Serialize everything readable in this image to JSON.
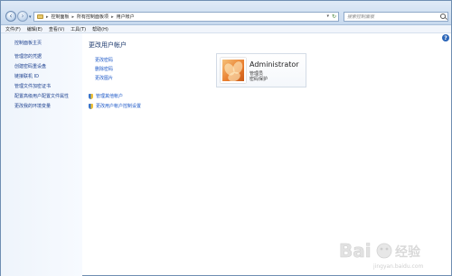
{
  "address_bar": {
    "crumbs": [
      "控制面板",
      "所有控制面板项",
      "用户帐户"
    ],
    "search_placeholder": "搜索控制面板"
  },
  "menu": {
    "items": [
      "文件(F)",
      "编辑(E)",
      "查看(V)",
      "工具(T)",
      "帮助(H)"
    ]
  },
  "left_pane": {
    "home": "控制面板主页",
    "links": [
      "管理您的凭据",
      "创建密码重设盘",
      "链接联机 ID",
      "管理文件加密证书",
      "配置高级用户配置文件属性",
      "更改我的环境变量"
    ]
  },
  "main": {
    "title": "更改用户帐户",
    "links": [
      "更改密码",
      "删除密码",
      "更改图片"
    ],
    "shield_links": [
      "管理其他帐户",
      "更改用户帐户控制设置"
    ]
  },
  "user": {
    "name": "Administrator",
    "role": "管理员",
    "password_status": "密码保护"
  },
  "watermark": {
    "text": "Bai 经验",
    "subtext": "jingyan.baidu.com"
  },
  "colors": {
    "link": "#1b57c7",
    "title": "#1e3a6e",
    "left_pane_bg": "#eef4fb"
  }
}
